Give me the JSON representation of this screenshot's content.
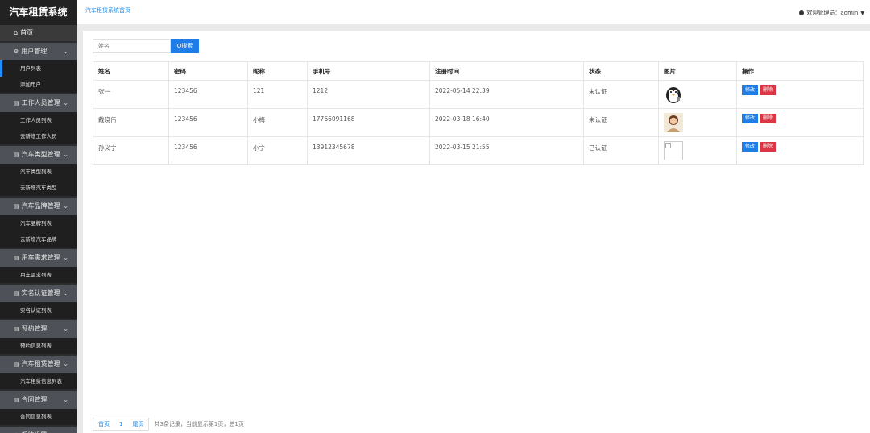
{
  "sidebar": {
    "brand": "汽车租赁系统",
    "home": "首页",
    "sections": [
      {
        "title": "用户管理",
        "icon": "gear-icon",
        "items": [
          "用户列表",
          "添加用户"
        ]
      },
      {
        "title": "工作人员管理",
        "icon": "doc-icon",
        "items": [
          "工作人员列表",
          "去新增工作人员"
        ]
      },
      {
        "title": "汽车类型管理",
        "icon": "doc-icon",
        "items": [
          "汽车类型列表",
          "去新增汽车类型"
        ]
      },
      {
        "title": "汽车品牌管理",
        "icon": "doc-icon",
        "items": [
          "汽车品牌列表",
          "去新增汽车品牌"
        ]
      },
      {
        "title": "用车需求管理",
        "icon": "doc-icon",
        "items": [
          "用车需求列表"
        ]
      },
      {
        "title": "实名认证管理",
        "icon": "doc-icon",
        "items": [
          "实名认证列表"
        ]
      },
      {
        "title": "预约管理",
        "icon": "doc-icon",
        "items": [
          "预约信息列表"
        ]
      },
      {
        "title": "汽车租赁管理",
        "icon": "doc-icon",
        "items": [
          "汽车租赁信息列表"
        ]
      },
      {
        "title": "合同管理",
        "icon": "doc-icon",
        "items": [
          "合同信息列表"
        ]
      },
      {
        "title": "系统设置",
        "icon": "gear-icon",
        "items": []
      }
    ]
  },
  "topbar": {
    "breadcrumb": "汽车租赁系统首页",
    "welcome": "欢迎管理员：admin"
  },
  "search": {
    "placeholder": "姓名",
    "button": "Q搜索"
  },
  "table": {
    "headers": [
      "姓名",
      "密码",
      "昵称",
      "手机号",
      "注册时间",
      "状态",
      "图片",
      "操作"
    ],
    "rows": [
      {
        "name": "张一",
        "password": "123456",
        "nickname": "121",
        "phone": "1212",
        "time": "2022-05-14 22:39",
        "status": "未认证",
        "pic": "penguin-avatar"
      },
      {
        "name": "戴晓伟",
        "password": "123456",
        "nickname": "小梅",
        "phone": "17766091168",
        "time": "2022-03-18 16:40",
        "status": "未认证",
        "pic": "woman-avatar"
      },
      {
        "name": "孙义宁",
        "password": "123456",
        "nickname": "小宁",
        "phone": "13912345678",
        "time": "2022-03-15 21:55",
        "status": "已认证",
        "pic": "broken-image"
      }
    ],
    "edit_label": "修改",
    "delete_label": "删除"
  },
  "pager": {
    "first": "首页",
    "current": "1",
    "last": "尾页",
    "info": "共3条记录，当前显示第1页，总1页"
  },
  "colors": {
    "primary": "#1e7de6",
    "danger": "#dc3545",
    "sidebar_bg": "#2c2c2c",
    "sidebar_header": "#4e5258"
  }
}
